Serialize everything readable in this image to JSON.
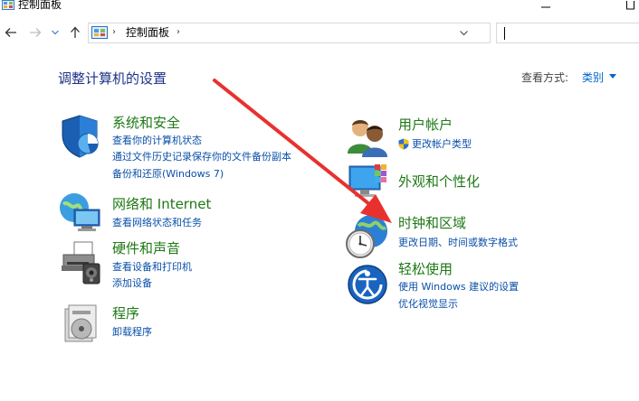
{
  "window": {
    "title": "控制面板"
  },
  "address_bar": {
    "crumbs": [
      "控制面板"
    ],
    "search_placeholder": ""
  },
  "main": {
    "heading": "调整计算机的设置",
    "view_by_label": "查看方式:",
    "view_by_value": "类别",
    "left_categories": [
      {
        "title": "系统和安全",
        "icon": "shield-icon",
        "links": [
          "查看你的计算机状态",
          "通过文件历史记录保存你的文件备份副本",
          "备份和还原(Windows 7)"
        ]
      },
      {
        "title": "网络和 Internet",
        "icon": "network-globe-icon",
        "links": [
          "查看网络状态和任务"
        ]
      },
      {
        "title": "硬件和声音",
        "icon": "printer-icon",
        "links": [
          "查看设备和打印机",
          "添加设备"
        ]
      },
      {
        "title": "程序",
        "icon": "program-disc-icon",
        "links": [
          "卸载程序"
        ]
      }
    ],
    "right_categories": [
      {
        "title": "用户帐户",
        "icon": "users-icon",
        "links": [
          "更改帐户类型"
        ]
      },
      {
        "title": "外观和个性化",
        "icon": "monitor-palette-icon",
        "links": []
      },
      {
        "title": "时钟和区域",
        "icon": "clock-globe-icon",
        "links": [
          "更改日期、时间或数字格式"
        ]
      },
      {
        "title": "轻松使用",
        "icon": "ease-of-access-icon",
        "links": [
          "使用 Windows 建议的设置",
          "优化视觉显示"
        ]
      }
    ]
  },
  "colors": {
    "category_title": "#1e7814",
    "link": "#0a4fa8",
    "heading": "#1e3287",
    "annotation_arrow": "#e8312f"
  }
}
